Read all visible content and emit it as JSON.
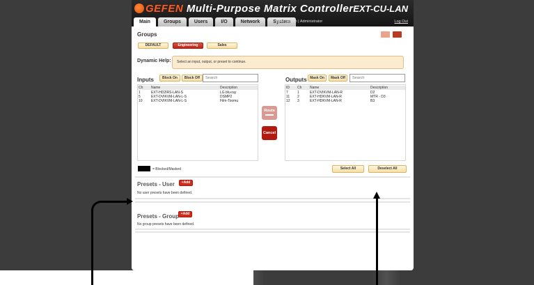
{
  "header": {
    "brand_red": "GEFEN",
    "brand_white": "Multi-Purpose Matrix Controller",
    "model": "EXT-CU-LAN"
  },
  "tabs": [
    "Main",
    "Groups",
    "Users",
    "I/O",
    "Network",
    "System"
  ],
  "user": {
    "info": "User: admin  |  Administrator",
    "logout": "Log Out"
  },
  "groups": {
    "title": "Groups",
    "buttons": [
      "DEFAULT",
      "Engineering",
      "Sales"
    ],
    "selected": "Engineering"
  },
  "help": {
    "label": "Dynamic Help:",
    "text": "Select an input, output, or preset to continue."
  },
  "inputs": {
    "title": "Inputs",
    "block_on": "Block On",
    "block_off": "Block Off",
    "search_placeholder": "Search",
    "columns": [
      "Ch",
      "Name",
      "Description"
    ],
    "rows": [
      [
        "1",
        "EXT-HD2IRS-LAN-S",
        "LG blu-ray"
      ],
      [
        "5",
        "EXT-DVIKVM-LAN-L-S",
        "DSMP2"
      ],
      [
        "10",
        "EXT-DVIKVM-LAN-L-S",
        "Film-Toomu"
      ]
    ]
  },
  "outputs": {
    "title": "Outputs",
    "mask_on": "Mask On",
    "mask_off": "Mask Off",
    "search_placeholder": "Search",
    "columns": [
      "ID",
      "Ch",
      "Name",
      "Description"
    ],
    "rows": [
      [
        "7",
        "1",
        "EXT-DVIKVM-LAN-R",
        "D2"
      ],
      [
        "11",
        "2",
        "EXT-HDKVM-LAN-R",
        "MTR - D3"
      ],
      [
        "12",
        "3",
        "EXT-HDKVM-LAN-R",
        "B3"
      ]
    ]
  },
  "actions": {
    "route": "Route",
    "cancel": "Cancel",
    "select_all": "Select All",
    "deselect_all": "Deselect All"
  },
  "legend": "= Blocked/Masked",
  "presets_user": {
    "title": "Presets - User",
    "add": "+Add",
    "empty": "No user presets have been defined."
  },
  "presets_group": {
    "title": "Presets - Group",
    "add": "+Add",
    "empty": "No group presets have been defined."
  },
  "colors": {
    "accent_red": "#d42a1a",
    "brand_orange": "#ff5a1f",
    "help_bg": "#fdebd0",
    "button_bg": "#fff5dc"
  },
  "icons": [
    "gefen-logo-icon",
    "route-arrow-icon",
    "list-view-icon",
    "grid-view-icon"
  ]
}
